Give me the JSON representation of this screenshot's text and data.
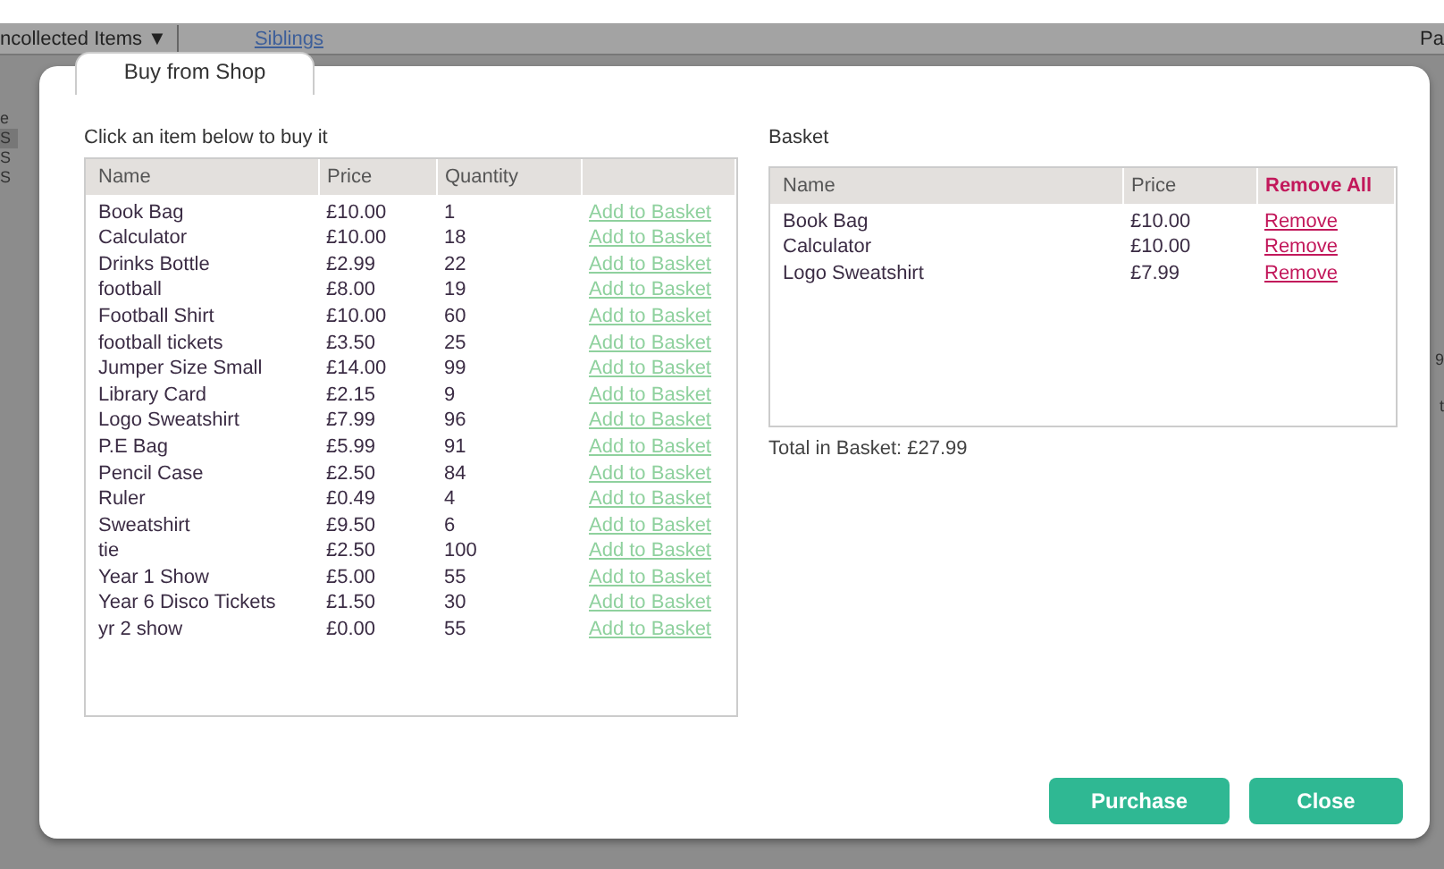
{
  "background": {
    "menu": {
      "label": "ncollected Items ▼"
    },
    "link": "Siblings",
    "right_text": "Pa",
    "side_letters": [
      "e",
      "S",
      "S",
      "S"
    ],
    "right_letters": [
      "9",
      "t"
    ]
  },
  "dialog": {
    "tabs": [
      {
        "label": "Buy from Shop",
        "selected": true
      }
    ],
    "shop": {
      "instruction": "Click an item below to buy it",
      "columns": [
        "Name",
        "Price",
        "Quantity"
      ],
      "rows": [
        {
          "name": "Book Bag",
          "price": "£10.00",
          "quantity": "1",
          "action": "Add to Basket"
        },
        {
          "name": "Calculator",
          "price": "£10.00",
          "quantity": "18",
          "action": "Add to Basket"
        },
        {
          "name": "Drinks Bottle",
          "price": "£2.99",
          "quantity": "22",
          "action": "Add to Basket"
        },
        {
          "name": "football",
          "price": "£8.00",
          "quantity": "19",
          "action": "Add to Basket"
        },
        {
          "name": "Football Shirt",
          "price": "£10.00",
          "quantity": "60",
          "action": "Add to Basket"
        },
        {
          "name": "football tickets",
          "price": "£3.50",
          "quantity": "25",
          "action": "Add to Basket"
        },
        {
          "name": "Jumper Size Small",
          "price": "£14.00",
          "quantity": "99",
          "action": "Add to Basket"
        },
        {
          "name": "Library Card",
          "price": "£2.15",
          "quantity": "9",
          "action": "Add to Basket"
        },
        {
          "name": "Logo Sweatshirt",
          "price": "£7.99",
          "quantity": "96",
          "action": "Add to Basket"
        },
        {
          "name": "P.E Bag",
          "price": "£5.99",
          "quantity": "91",
          "action": "Add to Basket"
        },
        {
          "name": "Pencil Case",
          "price": "£2.50",
          "quantity": "84",
          "action": "Add to Basket"
        },
        {
          "name": "Ruler",
          "price": "£0.49",
          "quantity": "4",
          "action": "Add to Basket"
        },
        {
          "name": "Sweatshirt",
          "price": "£9.50",
          "quantity": "6",
          "action": "Add to Basket"
        },
        {
          "name": "tie",
          "price": "£2.50",
          "quantity": "100",
          "action": "Add to Basket"
        },
        {
          "name": "Year 1 Show",
          "price": "£5.00",
          "quantity": "55",
          "action": "Add to Basket"
        },
        {
          "name": "Year 6 Disco Tickets",
          "price": "£1.50",
          "quantity": "30",
          "action": "Add to Basket"
        },
        {
          "name": "yr 2 show",
          "price": "£0.00",
          "quantity": "55",
          "action": "Add to Basket"
        }
      ]
    },
    "basket": {
      "title": "Basket",
      "columns": [
        "Name",
        "Price"
      ],
      "remove_all": "Remove All",
      "rows": [
        {
          "name": "Book Bag",
          "price": "£10.00",
          "action": "Remove"
        },
        {
          "name": "Calculator",
          "price": "£10.00",
          "action": "Remove"
        },
        {
          "name": "Logo Sweatshirt",
          "price": "£7.99",
          "action": "Remove"
        }
      ],
      "total": "Total in Basket: £27.99"
    },
    "buttons": [
      "Purchase",
      "Close"
    ]
  }
}
